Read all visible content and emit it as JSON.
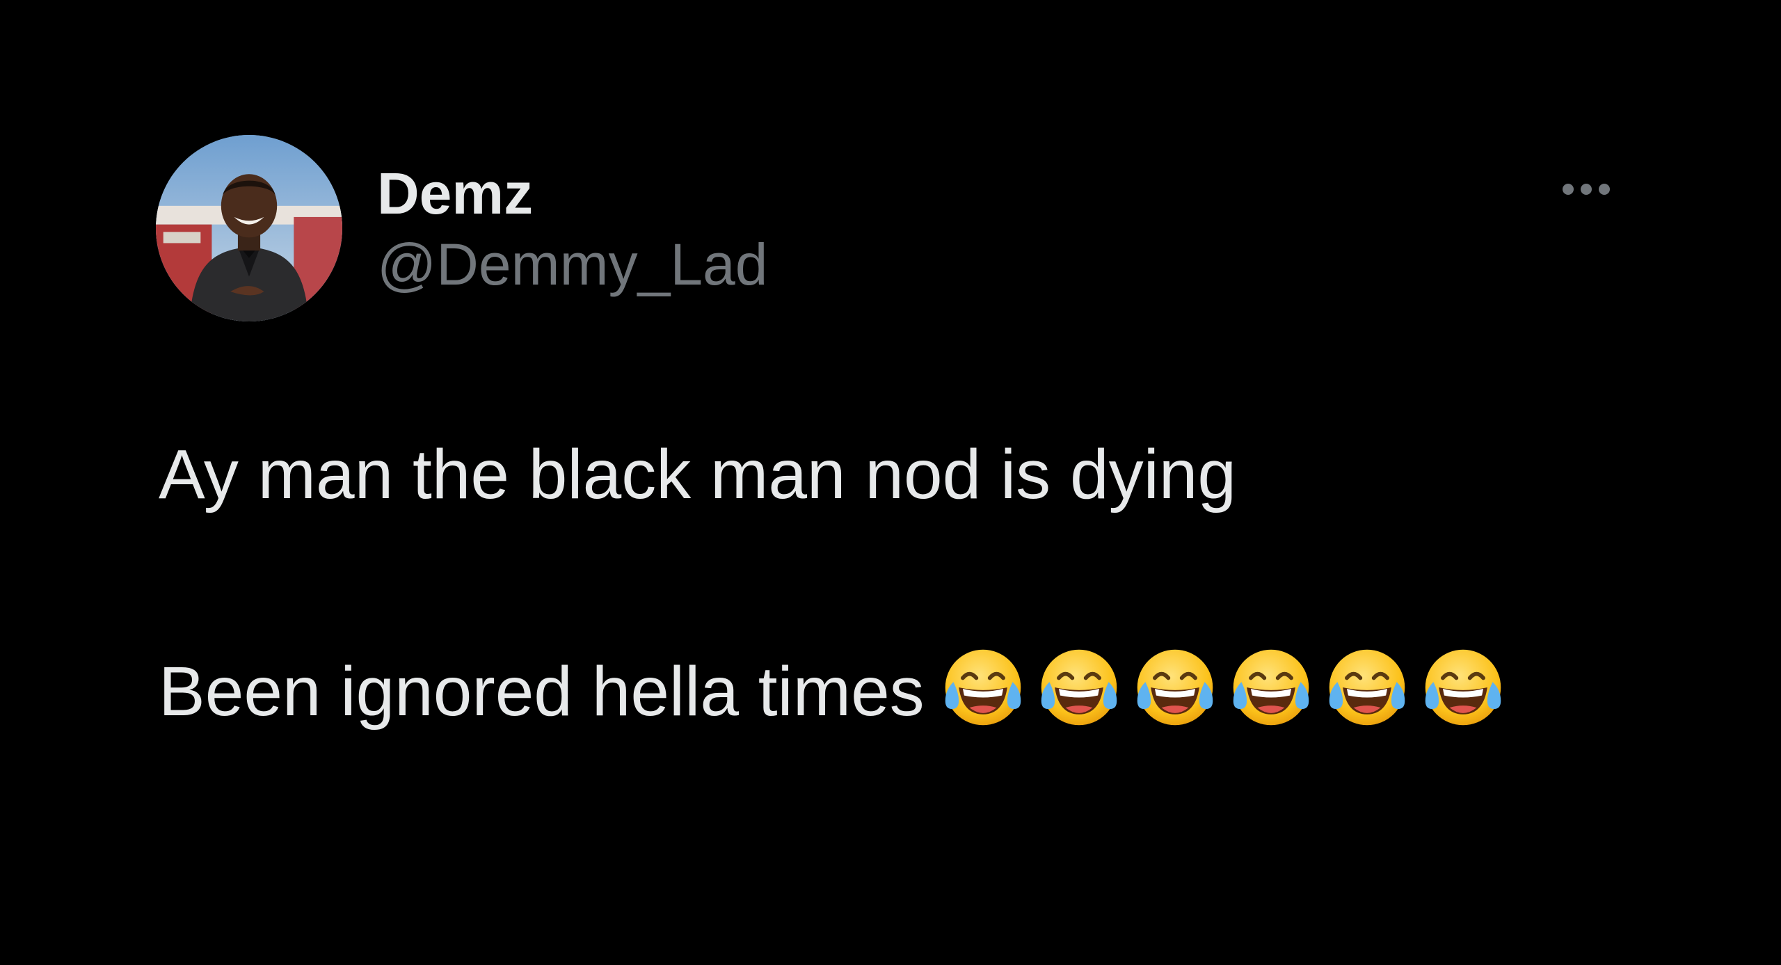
{
  "tweet": {
    "author": {
      "display_name": "Demz",
      "handle": "@Demmy_Lad"
    },
    "more_icon": "more-horizontal-icon",
    "text_lines": [
      "Ay man the black man nod is dying",
      "Been ignored hella times"
    ],
    "emoji": {
      "name": "face-with-tears-of-joy",
      "count": 6
    }
  },
  "colors": {
    "background": "#000000",
    "primary_text": "#e7e9ea",
    "secondary_text": "#71767b"
  }
}
